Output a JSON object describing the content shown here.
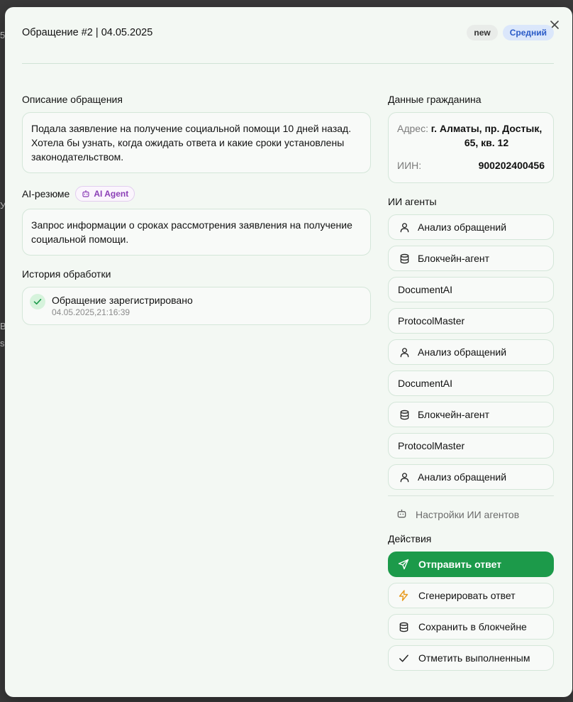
{
  "backdrop": {
    "fragments": [
      "5",
      "У",
      "В",
      "s"
    ]
  },
  "header": {
    "title": "Обращение #2 | 04.05.2025",
    "status_badge": "new",
    "priority_badge": "Средний",
    "close_label": "×"
  },
  "description": {
    "title": "Описание обращения",
    "text": "Подала заявление на получение социальной помощи 10 дней назад. Хотела бы узнать, когда ожидать ответа и какие сроки установлены законодательством."
  },
  "summary": {
    "title": "AI-резюме",
    "chip_label": "AI Agent",
    "text": "Запрос информации о сроках рассмотрения заявления на получение социальной помощи."
  },
  "history": {
    "title": "История обработки",
    "items": [
      {
        "event": "Обращение зарегистрировано",
        "time": "04.05.2025,21:16:39"
      }
    ]
  },
  "citizen": {
    "title": "Данные гражданина",
    "address_label": "Адрес:",
    "address_value": "г. Алматы, пр. Достык, 65, кв. 12",
    "iin_label": "ИИН:",
    "iin_value": "900202400456"
  },
  "agents": {
    "title": "ИИ агенты",
    "items": [
      {
        "label": "Анализ обращений",
        "icon": "user-icon"
      },
      {
        "label": "Блокчейн-агент",
        "icon": "database-icon"
      },
      {
        "label": "DocumentAI",
        "icon": ""
      },
      {
        "label": "ProtocolMaster",
        "icon": ""
      },
      {
        "label": "Анализ обращений",
        "icon": "user-icon"
      },
      {
        "label": "DocumentAI",
        "icon": ""
      },
      {
        "label": "Блокчейн-агент",
        "icon": "database-icon"
      },
      {
        "label": "ProtocolMaster",
        "icon": ""
      },
      {
        "label": "Анализ обращений",
        "icon": "user-icon"
      }
    ],
    "settings_label": "Настройки ИИ агентов"
  },
  "actions": {
    "title": "Действия",
    "send_label": "Отправить ответ",
    "generate_label": "Сгенерировать ответ",
    "blockchain_label": "Сохранить в блокчейне",
    "complete_label": "Отметить выполненным"
  },
  "colors": {
    "modal_bg": "#f3f8f3",
    "primary_green": "#1c9a4a",
    "priority_blue": "#2a5bc7",
    "ai_purple": "#8b3fb6",
    "lightning_orange": "#e89a1c"
  }
}
